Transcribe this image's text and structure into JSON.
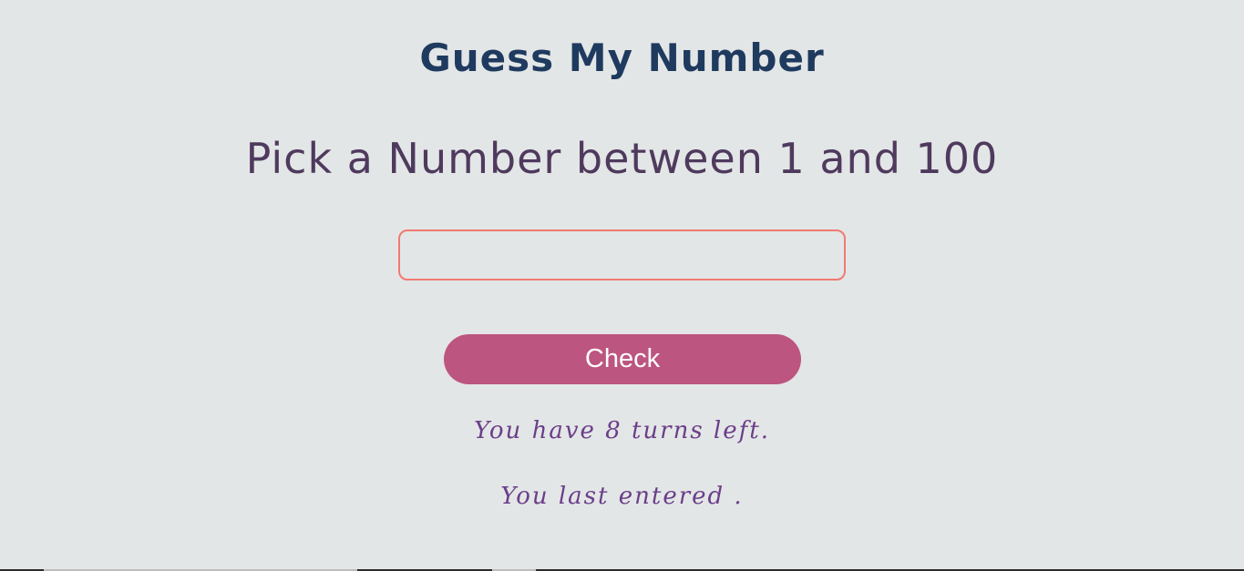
{
  "header": {
    "title": "Guess My Number"
  },
  "main": {
    "prompt": "Pick a Number between 1 and 100",
    "guess_input": {
      "value": "",
      "placeholder": ""
    },
    "check_label": "Check",
    "turns_text": "You have 8 turns left.",
    "last_entered_text": "You last entered ."
  },
  "colors": {
    "background": "#e3e6e6",
    "title": "#1f3a5f",
    "prompt": "#4f3a5e",
    "input_border": "#f07a72",
    "button": "#bc5580",
    "status_text": "#6b3e8a"
  }
}
